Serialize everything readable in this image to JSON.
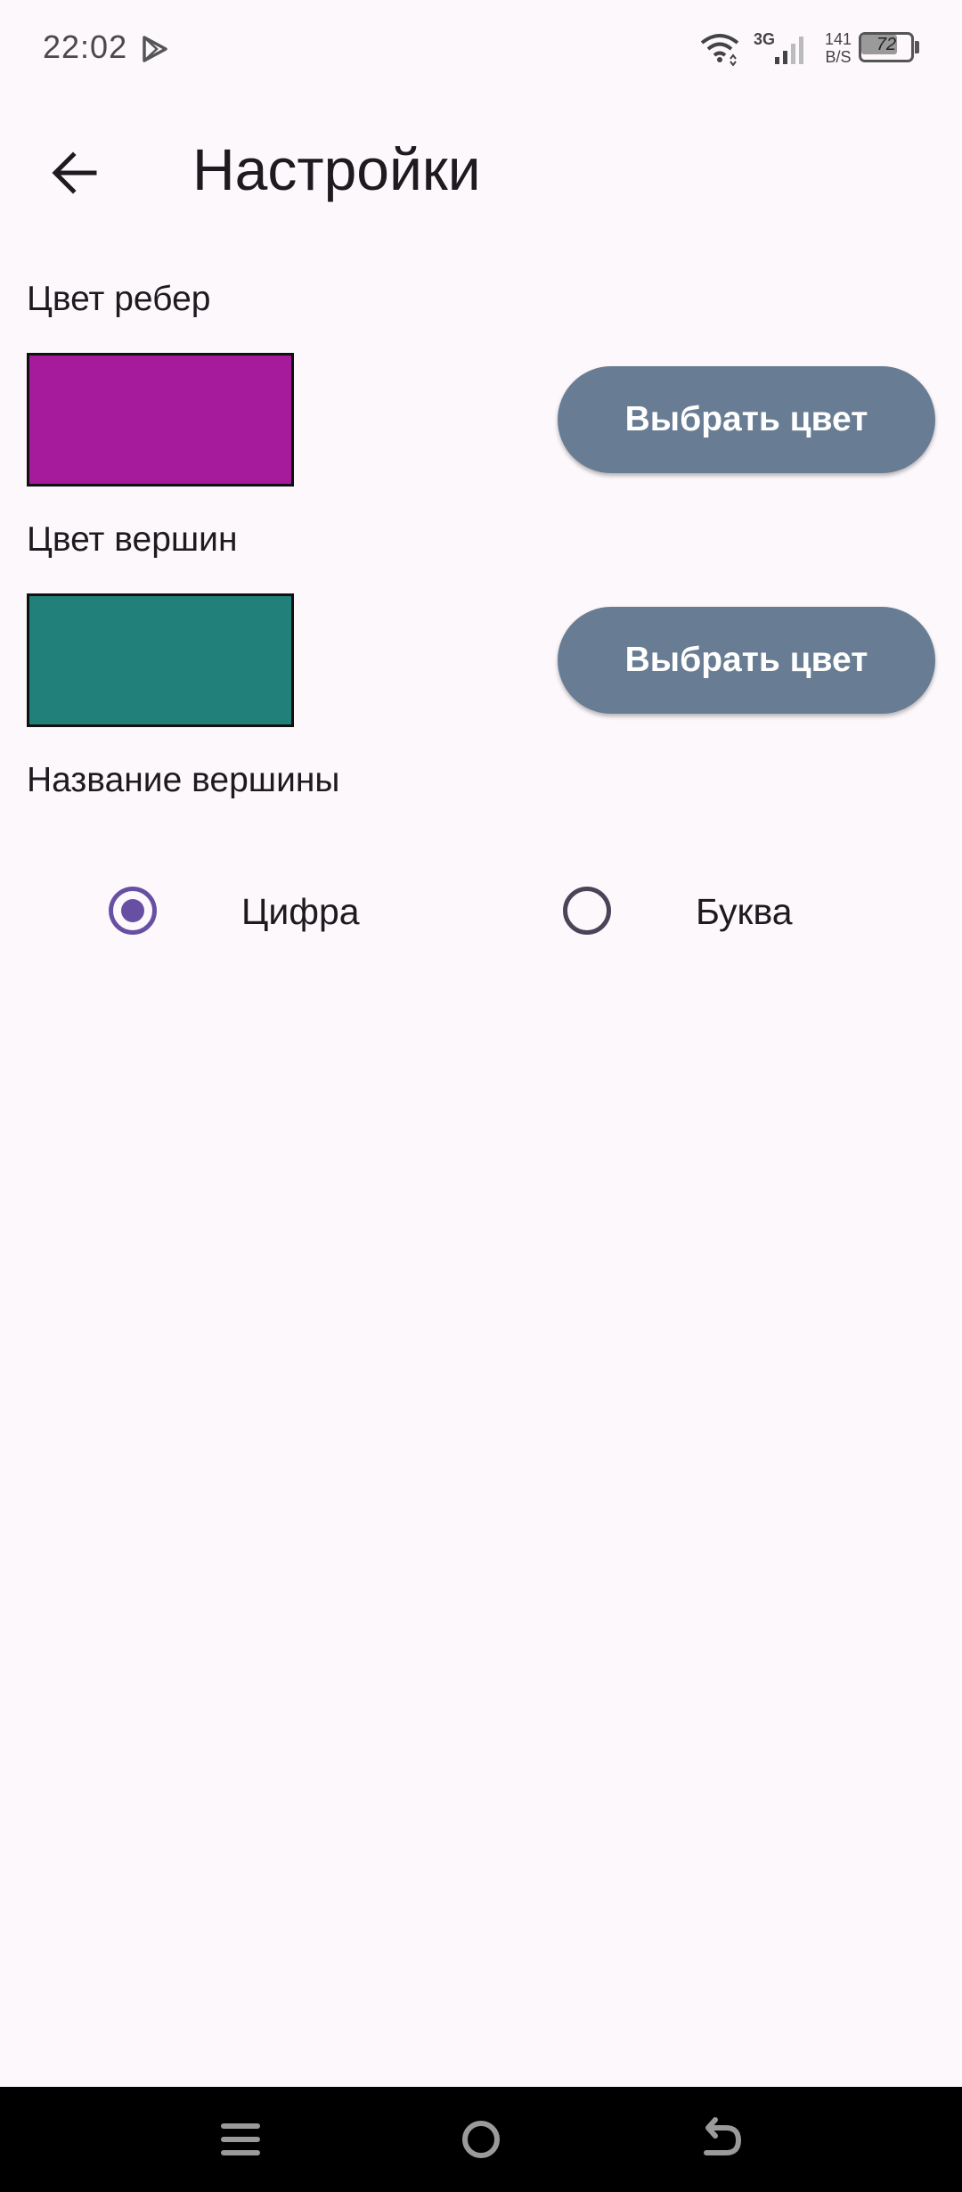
{
  "status_bar": {
    "time": "22:02",
    "network_type": "3G",
    "speed_value": "141",
    "speed_unit": "B/S",
    "battery_level": "72",
    "icons": [
      "play-icon",
      "wifi-icon",
      "signal-icon",
      "battery-icon"
    ]
  },
  "app_bar": {
    "title": "Настройки",
    "back_icon": "arrow-back-icon"
  },
  "edge_color": {
    "label": "Цвет ребер",
    "color": "#a51b9b",
    "button_label": "Выбрать цвет"
  },
  "vertex_color": {
    "label": "Цвет вершин",
    "color": "#22807a",
    "button_label": "Выбрать цвет"
  },
  "vertex_name": {
    "label": "Название вершины",
    "options": [
      {
        "label": "Цифра",
        "selected": true
      },
      {
        "label": "Буква",
        "selected": false
      }
    ]
  },
  "colors": {
    "background": "#fdf8fb",
    "button": "#687d94",
    "radio_accent": "#6750a4"
  },
  "nav_bar": {
    "icons": [
      "menu-icon",
      "home-icon",
      "back-icon"
    ]
  }
}
